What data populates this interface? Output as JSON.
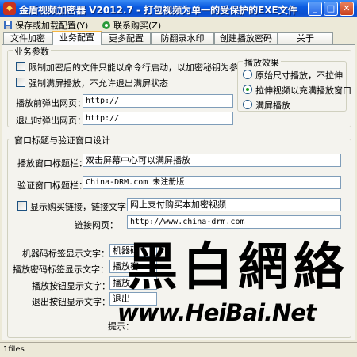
{
  "window": {
    "title": "金盾视频加密器 V2012.7 - 打包视频为单一的受保护的EXE文件",
    "icon": "shield-icon"
  },
  "menu": {
    "save_load": "保存或加载配置(Y)",
    "contact": "联系购买(Z)"
  },
  "tabs": [
    "文件加密",
    "业务配置",
    "更多配置",
    "防翻录水印",
    "创建播放密码",
    "关于"
  ],
  "business": {
    "group_title": "业务参数",
    "restrict_cmd": "限制加密后的文件只能以命令行启动，以加密秘钥为参数启动",
    "force_fullscreen": "强制满屏播放，不允许退出满屏状态",
    "before_label": "播放前弹出网页：",
    "before_value": "http://",
    "exit_label": "退出时弹出网页：",
    "exit_value": "http://"
  },
  "effect": {
    "group_title": "播放效果",
    "options": [
      "原始尺寸播放，不拉伸",
      "拉伸视频以充满播放窗口",
      "满屏播放"
    ],
    "selected": 1
  },
  "window_design": {
    "group_title": "窗口标题与验证窗口设计",
    "play_title_label": "播放窗口标题栏：",
    "play_title_value": "双击屏幕中心可以满屏播放",
    "verify_title_label": "验证窗口标题栏：",
    "verify_title_value": "China-DRM.com 未注册版",
    "show_buy_label": "显示购买链接，链接文字：",
    "show_buy_value": "网上支付购买本加密视频",
    "link_label": "链接网页：",
    "link_value": "http://www.china-drm.com"
  },
  "labels": {
    "machine_code_label": "机器码标签显示文字：",
    "machine_code_value": "机器码",
    "play_pwd_label": "播放密码标签显示文字：",
    "play_pwd_value": "播放密",
    "play_btn_label": "播放按钮显示文字：",
    "play_btn_value": "播放",
    "exit_btn_label": "退出按钮显示文字：",
    "exit_btn_value": "退出",
    "hint_label": "提示："
  },
  "watermark": {
    "chars": [
      "黑",
      "白",
      "網",
      "絡"
    ],
    "url": "www.HeiBai.Net"
  },
  "status": {
    "text": "1files"
  },
  "colors": {
    "titlebar": "#0a4fd0",
    "tab_highlight": "#f9b740",
    "panel_bg": "#f4f3ee"
  }
}
